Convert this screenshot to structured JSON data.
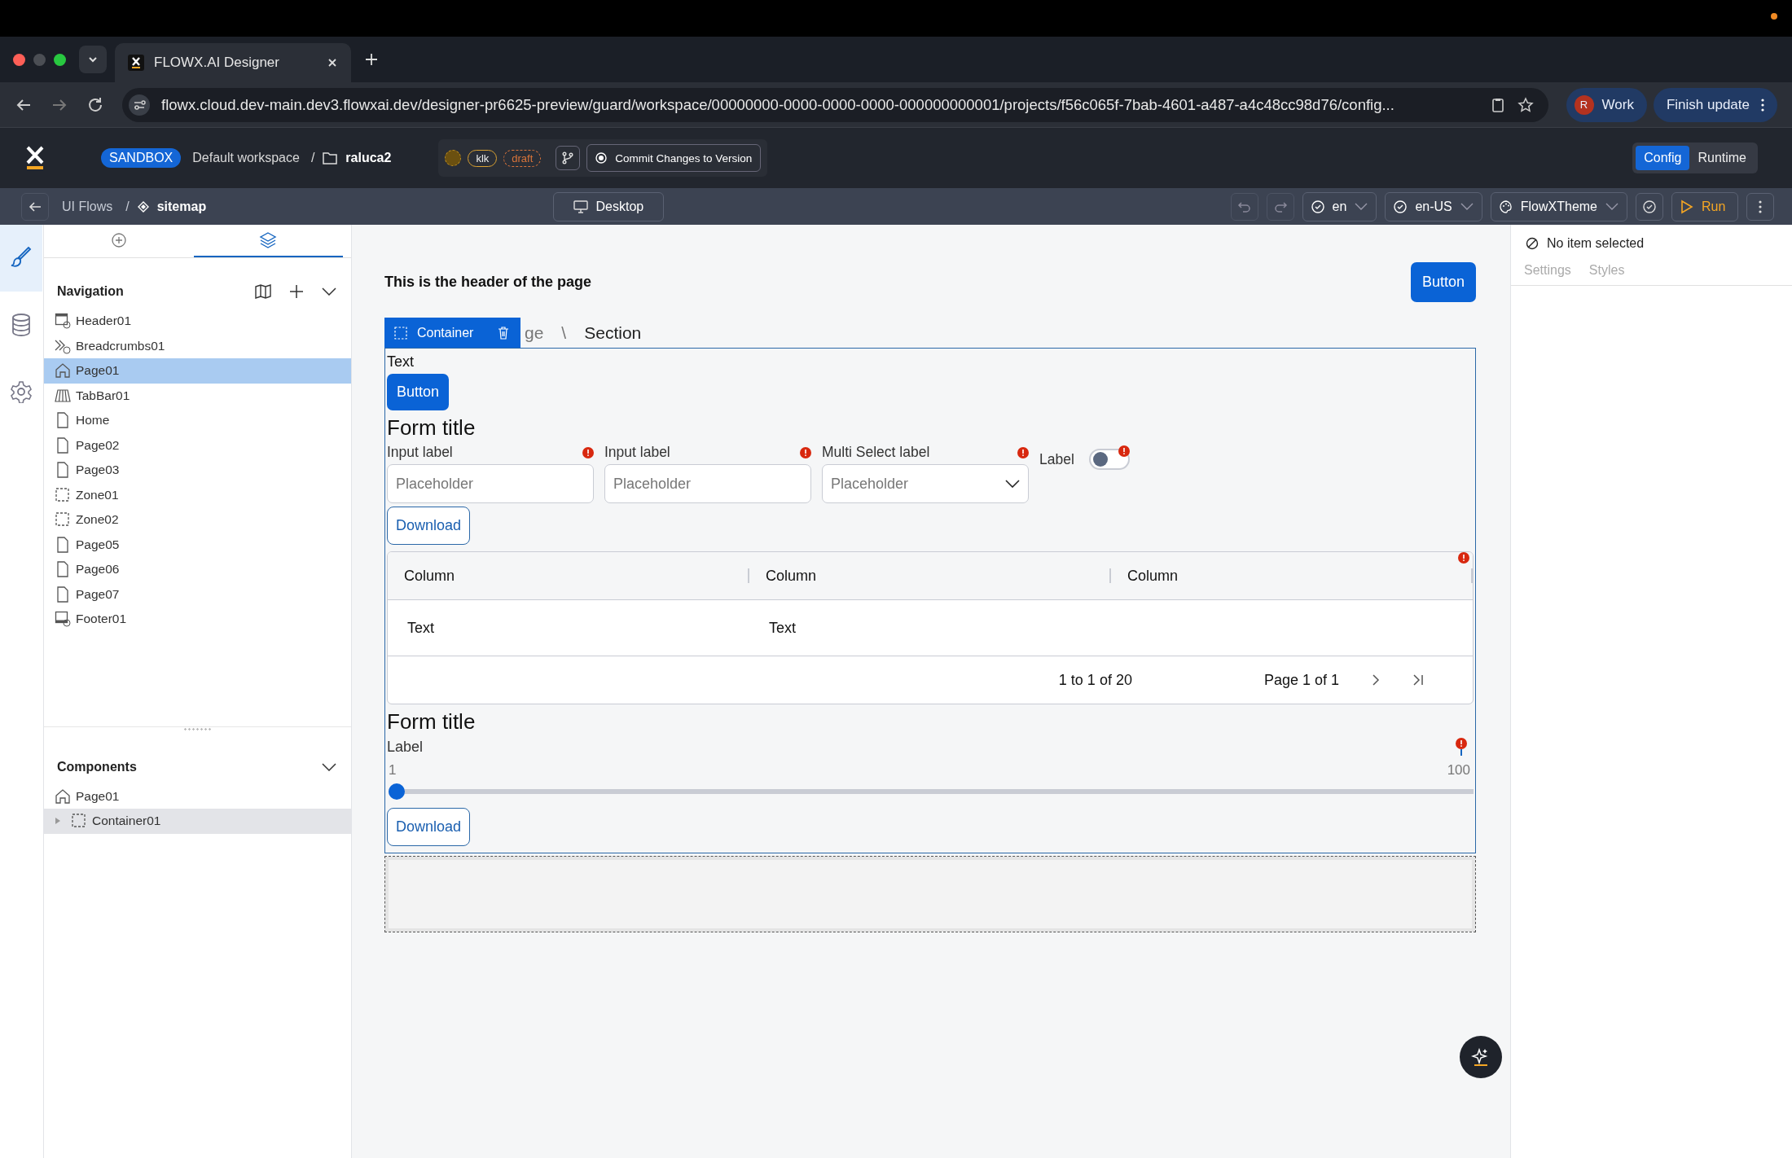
{
  "browser": {
    "tabs": [
      {
        "title": "FLOWX.AI Designer",
        "selected": true
      }
    ],
    "url": "flowx.cloud.dev-main.dev3.flowxai.dev/designer-pr6625-preview/guard/workspace/00000000-0000-0000-0000-000000000001/projects/f56c065f-7bab-4601-a487-a4c48cc98d76/config...",
    "profile_initial": "R",
    "profile": "Work",
    "update": "Finish update"
  },
  "app_header": {
    "badge": "SANDBOX",
    "workspace": "Default workspace",
    "separator": "/",
    "project": "raluca2",
    "tags": [
      {
        "label": "klk",
        "kind": "solid"
      },
      {
        "label": "draft",
        "kind": "dashed"
      }
    ],
    "commit": "Commit Changes to Version",
    "modes": [
      {
        "label": "Config",
        "selected": true
      },
      {
        "label": "Runtime",
        "selected": false
      }
    ]
  },
  "toolbar": {
    "breadcrumb": [
      "UI Flows",
      "sitemap"
    ],
    "separator": "/",
    "device": "Desktop",
    "selects": [
      "en",
      "en-US",
      "FlowXTheme"
    ],
    "run": "Run"
  },
  "rail": [
    {
      "kind": "brush",
      "selected": true
    },
    {
      "kind": "database",
      "selected": false
    },
    {
      "kind": "gear",
      "selected": false
    }
  ],
  "panel_tabs": [
    {
      "kind": "add",
      "selected": false
    },
    {
      "kind": "layers",
      "selected": true
    }
  ],
  "navigation": {
    "title": "Navigation",
    "items": [
      {
        "label": "Header01",
        "kind": "header",
        "selected": false
      },
      {
        "label": "Breadcrumbs01",
        "kind": "breadcrumbs",
        "selected": false
      },
      {
        "label": "Page01",
        "kind": "home",
        "selected": true
      },
      {
        "label": "TabBar01",
        "kind": "tabbar",
        "selected": false
      },
      {
        "label": "Home",
        "kind": "page",
        "selected": false
      },
      {
        "label": "Page02",
        "kind": "page",
        "selected": false
      },
      {
        "label": "Page03",
        "kind": "page",
        "selected": false
      },
      {
        "label": "Zone01",
        "kind": "zone",
        "selected": false
      },
      {
        "label": "Zone02",
        "kind": "zone",
        "selected": false
      },
      {
        "label": "Page05",
        "kind": "page",
        "selected": false
      },
      {
        "label": "Page06",
        "kind": "page",
        "selected": false
      },
      {
        "label": "Page07",
        "kind": "page",
        "selected": false
      },
      {
        "label": "Footer01",
        "kind": "footer",
        "selected": false
      }
    ]
  },
  "components": {
    "title": "Components",
    "items": [
      {
        "label": "Page01",
        "kind": "home",
        "selected": false,
        "expandable": false
      },
      {
        "label": "Container01",
        "kind": "zone",
        "selected": true,
        "expandable": true
      }
    ]
  },
  "canvas": {
    "header_text": "This is the header of the page",
    "header_button": "Button",
    "breadcrumb": [
      "ge",
      "Section"
    ],
    "breadcrumb_separator": "\\",
    "container_tag": "Container",
    "text": "Text",
    "button": "Button",
    "form1": {
      "title": "Form title",
      "fields": [
        {
          "kind": "input",
          "label": "Input label",
          "placeholder": "Placeholder",
          "error": true
        },
        {
          "kind": "input",
          "label": "Input label",
          "placeholder": "Placeholder",
          "error": true
        },
        {
          "kind": "select",
          "label": "Multi Select label",
          "placeholder": "Placeholder",
          "error": true
        }
      ],
      "toggle": {
        "label": "Label",
        "on": false,
        "error": true
      },
      "download": "Download"
    },
    "table": {
      "columns": [
        "Column",
        "Column",
        "Column"
      ],
      "rows": [
        [
          "Text",
          "Text"
        ]
      ],
      "error": true,
      "range": "1 to 1 of 20",
      "page": "Page 1 of 1"
    },
    "form2": {
      "title": "Form title",
      "slider": {
        "label": "Label",
        "min": "1",
        "max": "100",
        "level": 0,
        "error": true
      },
      "download": "Download"
    }
  },
  "right_panel": {
    "title": "No item selected",
    "tabs": [
      {
        "label": "Settings",
        "selected": false
      },
      {
        "label": "Styles",
        "selected": false
      }
    ]
  }
}
